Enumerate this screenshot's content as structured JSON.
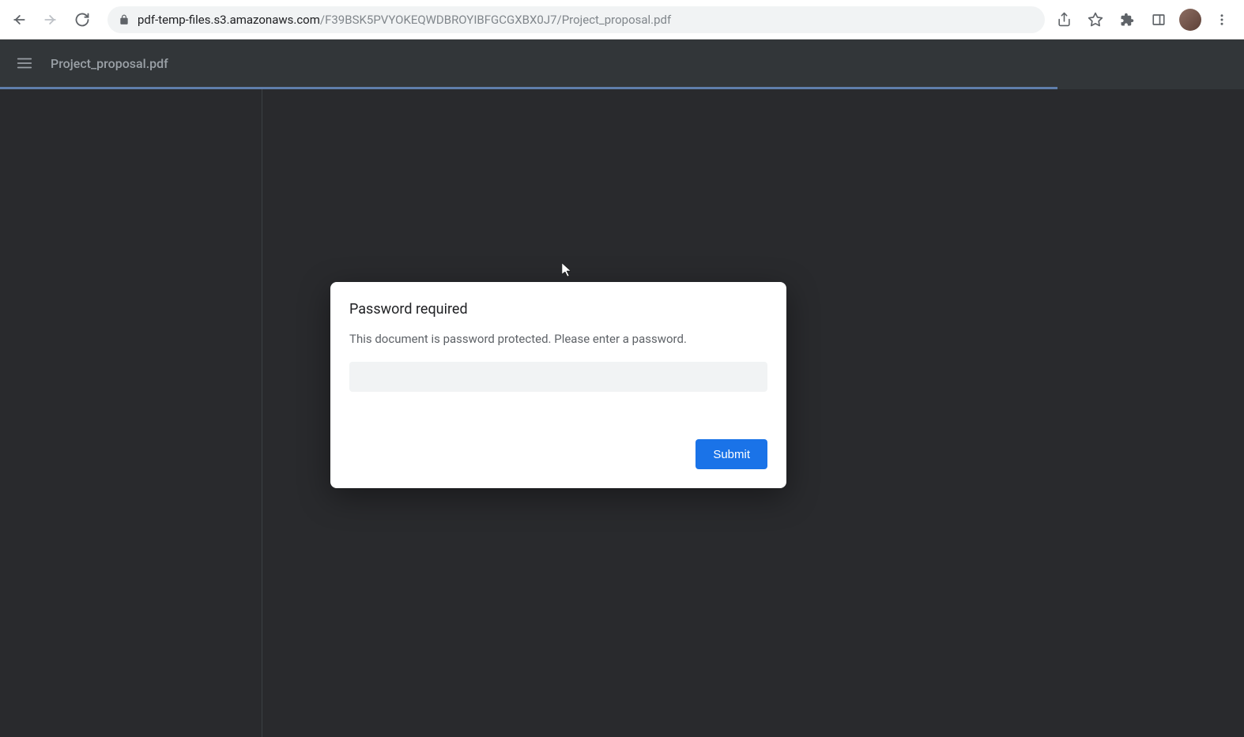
{
  "browser": {
    "url_host": "pdf-temp-files.s3.amazonaws.com",
    "url_path": "/F39BSK5PVYOKEQWDBROYIBFGCGXBX0J7/Project_proposal.pdf"
  },
  "pdf_viewer": {
    "filename": "Project_proposal.pdf"
  },
  "modal": {
    "title": "Password required",
    "message": "This document is password protected. Please enter a password.",
    "submit_label": "Submit",
    "password_value": ""
  }
}
